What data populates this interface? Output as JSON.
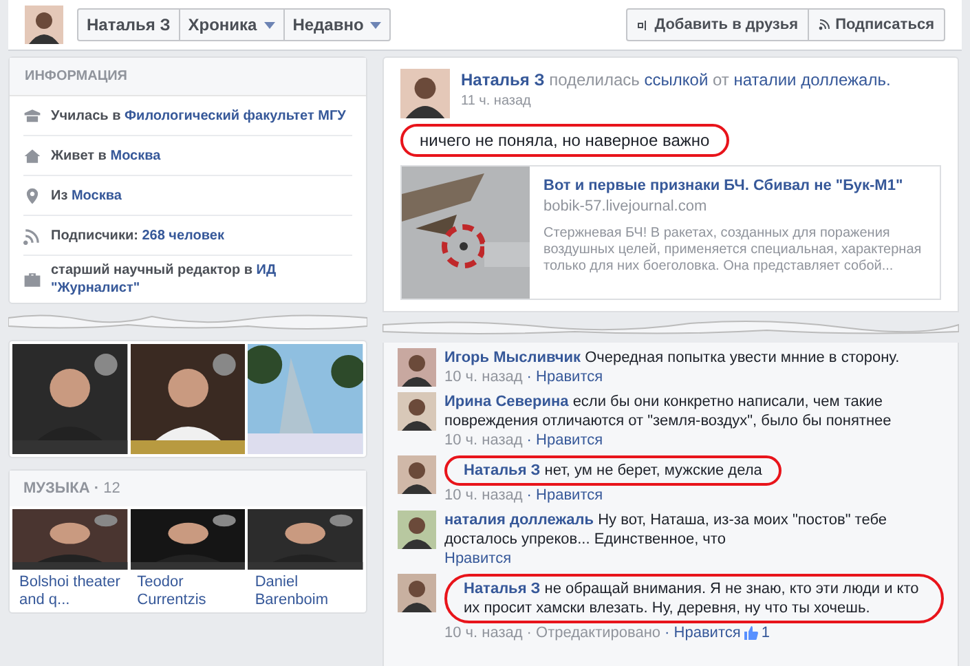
{
  "header": {
    "name_button": "Наталья З",
    "tabs": [
      {
        "label": "Хроника",
        "caret": true
      },
      {
        "label": "Недавно",
        "caret": true
      }
    ],
    "actions": [
      {
        "kind": "add",
        "label": "Добавить в друзья"
      },
      {
        "kind": "follow",
        "label": "Подписаться"
      }
    ]
  },
  "info": {
    "title": "ИНФОРМАЦИЯ",
    "rows": [
      {
        "kind": "school",
        "prefix": "Училась в",
        "link": "Филологический факультет МГУ"
      },
      {
        "kind": "home",
        "prefix": "Живет в",
        "link": "Москва"
      },
      {
        "kind": "pin",
        "prefix": "Из",
        "link": "Москва"
      },
      {
        "kind": "rss",
        "prefix": "Подписчики:",
        "link": "268 человек"
      },
      {
        "kind": "work",
        "prefix": "старший научный редактор в",
        "link": "ИД \"Журналист\""
      }
    ]
  },
  "music": {
    "title": "МУЗЫКА",
    "separator": "·",
    "count": "12",
    "items": [
      {
        "caption": "Bolshoi theater and q..."
      },
      {
        "caption": "Teodor Currentzis"
      },
      {
        "caption": "Daniel Barenboim"
      }
    ]
  },
  "post": {
    "author": "Наталья З",
    "action": "поделилась",
    "link_word": "ссылкой",
    "from": "от",
    "source": "наталии доллежаль.",
    "time": "11 ч. назад",
    "text": "ничего не поняла, но наверное важно",
    "highlighted": true,
    "preview": {
      "title": "Вот и первые признаки БЧ. Сбивал не \"Бук-М1\"",
      "domain": "bobik-57.livejournal.com",
      "description": "Стержневая БЧ! В ракетах, созданных для поражения воздушных целей, применяется специальная, характерная только для них боеголовка. Она представляет собой..."
    }
  },
  "meta_separator": "·",
  "comments": [
    {
      "author": "Игорь Мысливчик",
      "text": "Очередная попытка увести мнние в сторону.",
      "time": "10 ч. назад",
      "like": "Нравится",
      "highlighted": false
    },
    {
      "author": "Ирина Северина",
      "text": "если бы они конкретно написали, чем такие повреждения отличаются от \"земля-воздух\", было бы понятнее",
      "time": "10 ч. назад",
      "like": "Нравится",
      "highlighted": false
    },
    {
      "author": "Наталья З",
      "text": "нет, ум не берет, мужские дела",
      "time": "10 ч. назад",
      "like": "Нравится",
      "highlighted": true
    },
    {
      "author": "наталия доллежаль",
      "text": "Ну вот, Наташа, из-за моих \"постов\" тебе досталось упреков... Единственное, что",
      "like": "Нравится",
      "highlighted": false
    },
    {
      "author": "Наталья З",
      "text": "не обращай внимания. Я не знаю, кто эти люди и кто их просит хамски влезать. Ну, деревня, ну что ты хочешь.",
      "time": "10 ч. назад",
      "edited": "Отредактировано",
      "like": "Нравится",
      "likes": "1",
      "highlighted": true
    }
  ]
}
